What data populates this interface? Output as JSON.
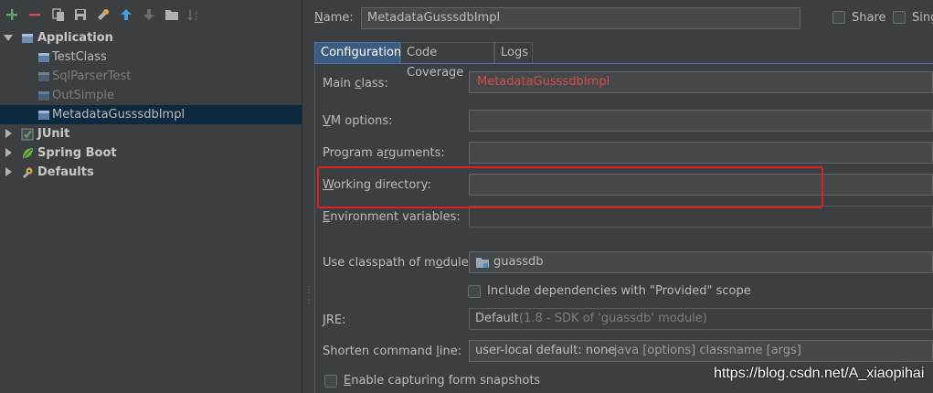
{
  "toolbar": {
    "icons": [
      "add-icon",
      "remove-icon",
      "copy-icon",
      "save-icon",
      "edit-defaults-icon",
      "move-up-icon",
      "move-down-icon",
      "folder-icon",
      "sort-icon"
    ]
  },
  "tree": {
    "application": "Application",
    "items": [
      "TestClass",
      "SqlParserTest",
      "OutSimple",
      "MetadataGusssdbImpl"
    ],
    "junit": "JUnit",
    "spring_boot": "Spring Boot",
    "defaults": "Defaults"
  },
  "header": {
    "name_label": "Name:",
    "name_value": "MetadataGusssdbImpl",
    "share_label": "Share",
    "single_label": "Sing"
  },
  "tabs": [
    "Configuration",
    "Code Coverage",
    "Logs"
  ],
  "form": {
    "main_class_label": "Main class:",
    "main_class_value": "MetadataGusssdbImpl",
    "vm_options_label": "VM options:",
    "program_args_label": "Program arguments:",
    "working_dir_label": "Working directory:",
    "env_vars_label": "Environment variables:",
    "classpath_label": "Use classpath of module:",
    "classpath_value": "guassdb",
    "include_deps_label": "Include dependencies with \"Provided\" scope",
    "jre_label": "JRE:",
    "jre_value": "Default",
    "jre_detail": "(1.8 - SDK of 'guassdb' module)",
    "shorten_label": "Shorten command line:",
    "shorten_value": "user-local default: none",
    "shorten_detail": "- java [options] classname [args]",
    "snapshots_label": "Enable capturing form snapshots"
  },
  "watermark": "https://blog.csdn.net/A_xiaopihai",
  "colors": {
    "background": "#3c3f41",
    "selection": "#0d293e",
    "error_text": "#d64b48",
    "highlight_box": "#e0201f",
    "add_green": "#59a869",
    "remove_red": "#c75450"
  }
}
